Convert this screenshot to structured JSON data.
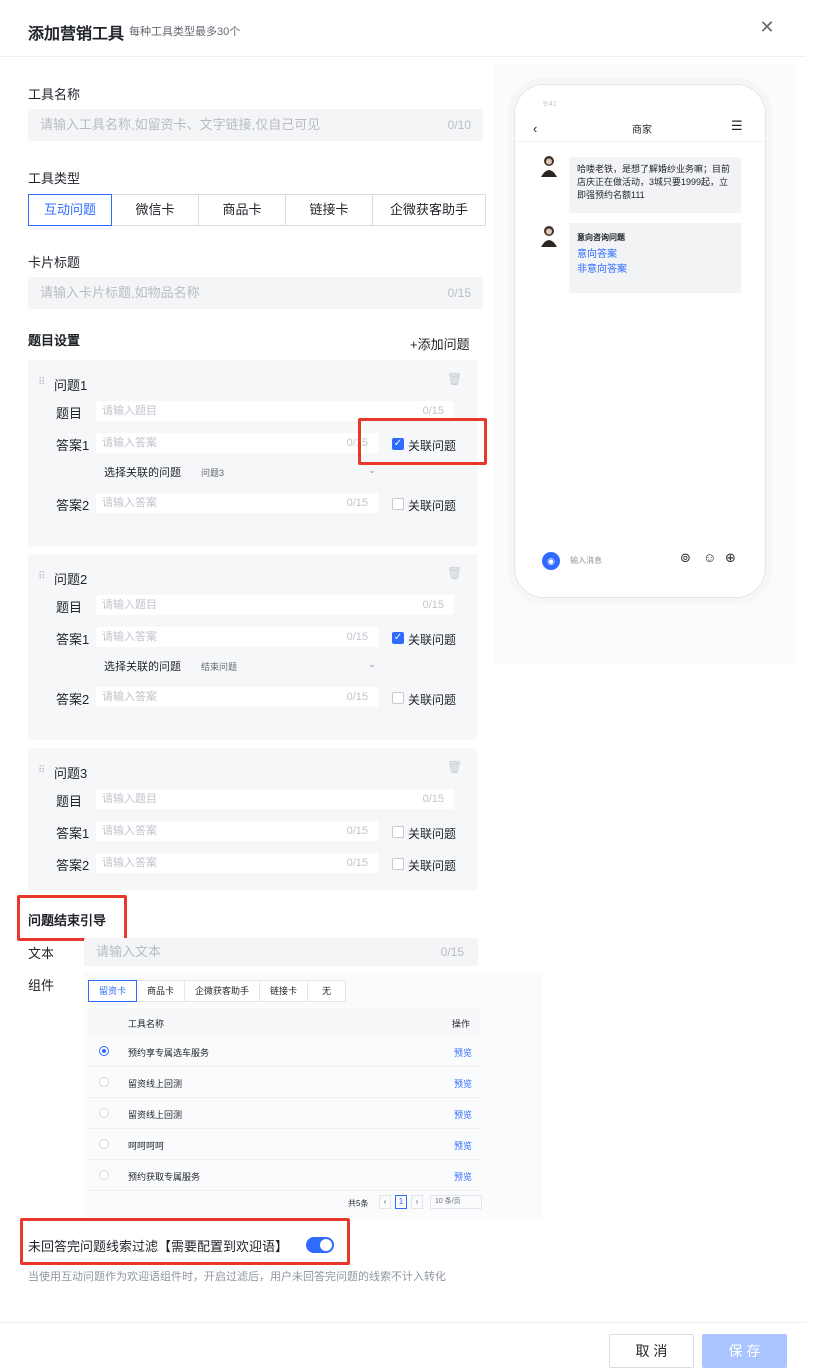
{
  "header": {
    "title": "添加营销工具",
    "subtitle": "每种工具类型最多30个",
    "close_icon": "close-icon"
  },
  "form": {
    "tool_name_label": "工具名称",
    "tool_name_placeholder": "请输入工具名称,如留资卡、文字链接,仅自己可见",
    "tool_name_counter": "0/10",
    "tool_type_label": "工具类型",
    "tool_types": [
      "互动问题",
      "微信卡",
      "商品卡",
      "链接卡",
      "企微获客助手"
    ],
    "tool_type_selected": "互动问题",
    "card_title_label": "卡片标题",
    "card_title_placeholder": "请输入卡片标题,如物品名称",
    "card_title_counter": "0/15",
    "question_settings_label": "题目设置",
    "add_question": "+添加问题"
  },
  "questions": [
    {
      "title": "问题1",
      "subject_label": "题目",
      "subject_placeholder": "请输入题目",
      "subject_counter": "0/15",
      "answer1_label": "答案1",
      "answer1_placeholder": "请输入答案",
      "answer1_counter": "0/15",
      "answer1_link_label": "关联问题",
      "answer1_linked": true,
      "linked_select_label": "选择关联的问题",
      "linked_select_value": "问题3",
      "answer2_label": "答案2",
      "answer2_placeholder": "请输入答案",
      "answer2_counter": "0/15",
      "answer2_link_label": "关联问题",
      "answer2_linked": false
    },
    {
      "title": "问题2",
      "subject_label": "题目",
      "subject_placeholder": "请输入题目",
      "subject_counter": "0/15",
      "answer1_label": "答案1",
      "answer1_placeholder": "请输入答案",
      "answer1_counter": "0/15",
      "answer1_link_label": "关联问题",
      "answer1_linked": true,
      "linked_select_label": "选择关联的问题",
      "linked_select_value": "结束问题",
      "answer2_label": "答案2",
      "answer2_placeholder": "请输入答案",
      "answer2_counter": "0/15",
      "answer2_link_label": "关联问题",
      "answer2_linked": false
    },
    {
      "title": "问题3",
      "subject_label": "题目",
      "subject_placeholder": "请输入题目",
      "subject_counter": "0/15",
      "answer1_label": "答案1",
      "answer1_placeholder": "请输入答案",
      "answer1_counter": "0/15",
      "answer1_link_label": "关联问题",
      "answer1_linked": false,
      "answer2_label": "答案2",
      "answer2_placeholder": "请输入答案",
      "answer2_counter": "0/15",
      "answer2_link_label": "关联问题",
      "answer2_linked": false
    }
  ],
  "ending": {
    "section_label": "问题结束引导",
    "text_label": "文本",
    "text_placeholder": "请输入文本",
    "text_counter": "0/15",
    "component_label": "组件",
    "component_tabs": [
      "留资卡",
      "商品卡",
      "企微获客助手",
      "链接卡",
      "无"
    ],
    "component_tab_selected": "留资卡",
    "table_header_name": "工具名称",
    "table_header_action": "操作",
    "rows": [
      {
        "name": "预约享专属选车服务",
        "action": "预览",
        "selected": true
      },
      {
        "name": "留资线上回测",
        "action": "预览",
        "selected": false
      },
      {
        "name": "留资线上回测",
        "action": "预览",
        "selected": false
      },
      {
        "name": "呵呵呵呵",
        "action": "预览",
        "selected": false
      },
      {
        "name": "预约获取专属服务",
        "action": "预览",
        "selected": false
      }
    ],
    "pagination_total": "共5条",
    "pagination_page": "1",
    "pagination_size": "10 条/页"
  },
  "filter": {
    "label": "未回答完问题线索过滤【需要配置到欢迎语】",
    "enabled": true,
    "hint": "当使用互动问题作为欢迎语组件时，开启过滤后，用户未回答完问题的线索不计入转化"
  },
  "preview": {
    "status_time": "9:41",
    "nav_title": "商家",
    "message1": "哈喽老铁，是想了解婚纱业务嘛；目前店庆正在做活动，3城只要1999起，立即强预约名额111",
    "message2_title": "意向咨询问题",
    "message2_options": [
      "意向答案",
      "非意向答案"
    ],
    "input_placeholder": "输入消息"
  },
  "footer": {
    "cancel": "取 消",
    "save": "保 存"
  },
  "colors": {
    "accent": "#2f6bff",
    "highlight_box": "#e8372c"
  }
}
